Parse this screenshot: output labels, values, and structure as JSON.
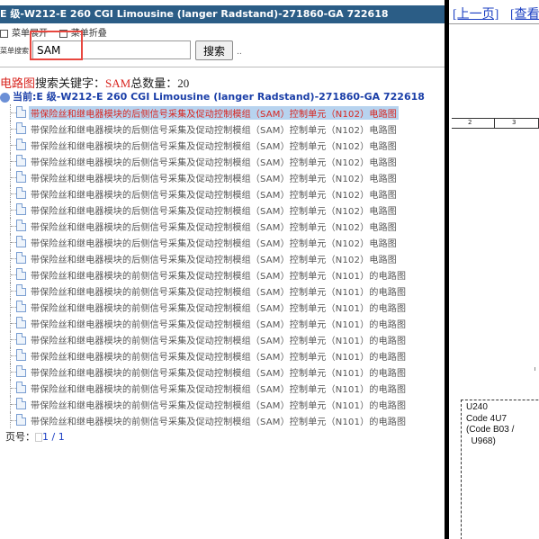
{
  "title": "E 级-W212-E 260 CGI Limousine (langer Radstand)-271860-GA 722618",
  "menu": {
    "expand_label": "菜单展开",
    "collapse_label": "菜单折叠"
  },
  "search": {
    "label": "菜单搜索",
    "value": "SAM",
    "button_label": "搜索",
    "trailing": ".."
  },
  "result": {
    "prefix": "电路图",
    "keyword_label": "搜索关键字：",
    "keyword": "SAM",
    "total_label": "总数量：",
    "total": "20"
  },
  "current": {
    "label": "当前:",
    "value": "E 级-W212-E 260 CGI Limousine (langer Radstand)-271860-GA 722618"
  },
  "items": [
    "带保险丝和继电器模块的后侧信号采集及促动控制模组（SAM）控制单元（N102）电路图",
    "带保险丝和继电器模块的后侧信号采集及促动控制模组（SAM）控制单元（N102）电路图",
    "带保险丝和继电器模块的后侧信号采集及促动控制模组（SAM）控制单元（N102）电路图",
    "带保险丝和继电器模块的后侧信号采集及促动控制模组（SAM）控制单元（N102）电路图",
    "带保险丝和继电器模块的后侧信号采集及促动控制模组（SAM）控制单元（N102）电路图",
    "带保险丝和继电器模块的后侧信号采集及促动控制模组（SAM）控制单元（N102）电路图",
    "带保险丝和继电器模块的后侧信号采集及促动控制模组（SAM）控制单元（N102）电路图",
    "带保险丝和继电器模块的后侧信号采集及促动控制模组（SAM）控制单元（N102）电路图",
    "带保险丝和继电器模块的后侧信号采集及促动控制模组（SAM）控制单元（N102）电路图",
    "带保险丝和继电器模块的后侧信号采集及促动控制模组（SAM）控制单元（N102）电路图",
    "带保险丝和继电器模块的前侧信号采集及促动控制模组（SAM）控制单元（N101）的电路图",
    "带保险丝和继电器模块的前侧信号采集及促动控制模组（SAM）控制单元（N101）的电路图",
    "带保险丝和继电器模块的前侧信号采集及促动控制模组（SAM）控制单元（N101）的电路图",
    "带保险丝和继电器模块的前侧信号采集及促动控制模组（SAM）控制单元（N101）的电路图",
    "带保险丝和继电器模块的前侧信号采集及促动控制模组（SAM）控制单元（N101）的电路图",
    "带保险丝和继电器模块的前侧信号采集及促动控制模组（SAM）控制单元（N101）的电路图",
    "带保险丝和继电器模块的前侧信号采集及促动控制模组（SAM）控制单元（N101）的电路图",
    "带保险丝和继电器模块的前侧信号采集及促动控制模组（SAM）控制单元（N101）的电路图",
    "带保险丝和继电器模块的前侧信号采集及促动控制模组（SAM）控制单元（N101）的电路图",
    "带保险丝和继电器模块的前侧信号采集及促动控制模组（SAM）控制单元（N101）的电路图"
  ],
  "pagination": {
    "label": "页号：",
    "value": "1 / 1"
  },
  "viewer": {
    "prev_label": "[上一页]",
    "view_label": "[查看",
    "col_labels": [
      "2",
      "3"
    ],
    "diagram_text": [
      "U240",
      "Code 4U7",
      "(Code B03  /",
      "  U968)"
    ]
  },
  "colors": {
    "title_bg": "#2b5d86",
    "highlight_red": "#d8251f",
    "selected_bg": "#b7d3ef",
    "link_blue": "#1a3ec2"
  }
}
